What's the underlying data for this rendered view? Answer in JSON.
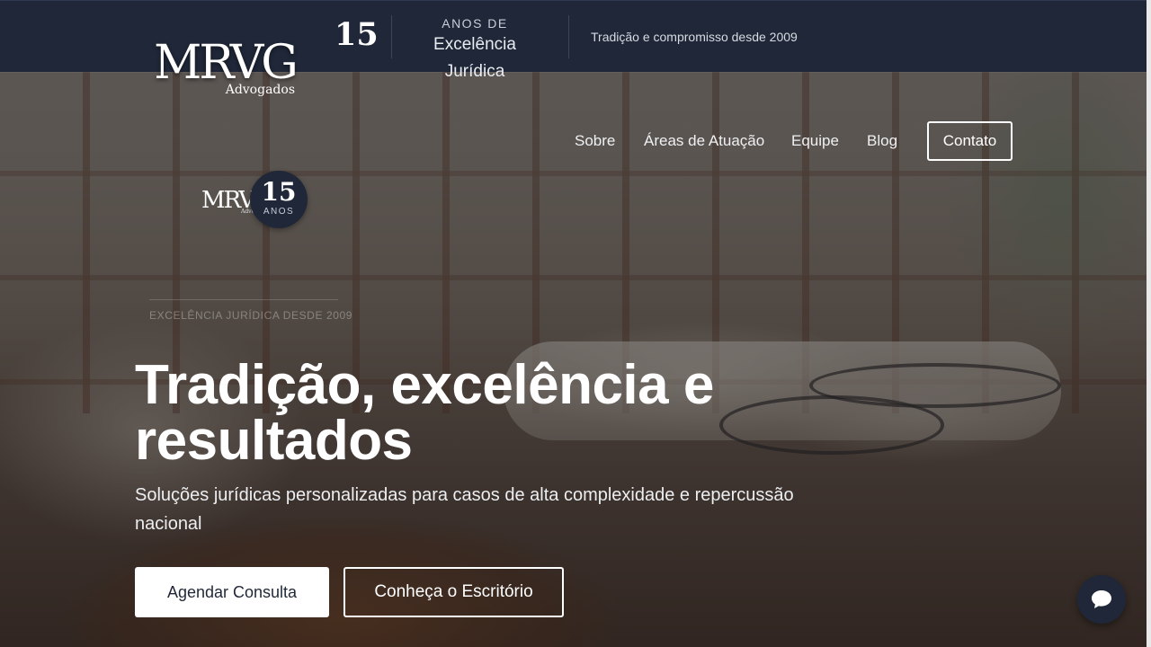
{
  "topbar": {
    "years_number": "15",
    "years_caption_small": "ANOS DE",
    "years_caption_big": "Excelência Jurídica",
    "tagline": "Tradição e compromisso desde 2009"
  },
  "logo": {
    "mark": "MRVG",
    "subtitle": "Advogados"
  },
  "nav": {
    "items": [
      {
        "label": "Sobre"
      },
      {
        "label": "Áreas de Atuação"
      },
      {
        "label": "Equipe"
      },
      {
        "label": "Blog"
      }
    ],
    "contact_label": "Contato"
  },
  "mini_logo": {
    "mark": "MRVG",
    "subtitle": "Advogados"
  },
  "badge": {
    "number": "15",
    "label": "ANOS"
  },
  "hero": {
    "eyebrow": "EXCELÊNCIA JURÍDICA DESDE 2009",
    "headline_line1": "Tradição, excelência e",
    "headline_line2": "resultados",
    "subheadline": "Soluções jurídicas personalizadas para casos de alta complexidade e repercussão nacional",
    "primary_cta": "Agendar Consulta",
    "secondary_cta": "Conheça o Escritório"
  },
  "chat": {
    "icon": "chat-bubble-icon"
  },
  "colors": {
    "navy": "#1f2738",
    "white": "#ffffff"
  }
}
